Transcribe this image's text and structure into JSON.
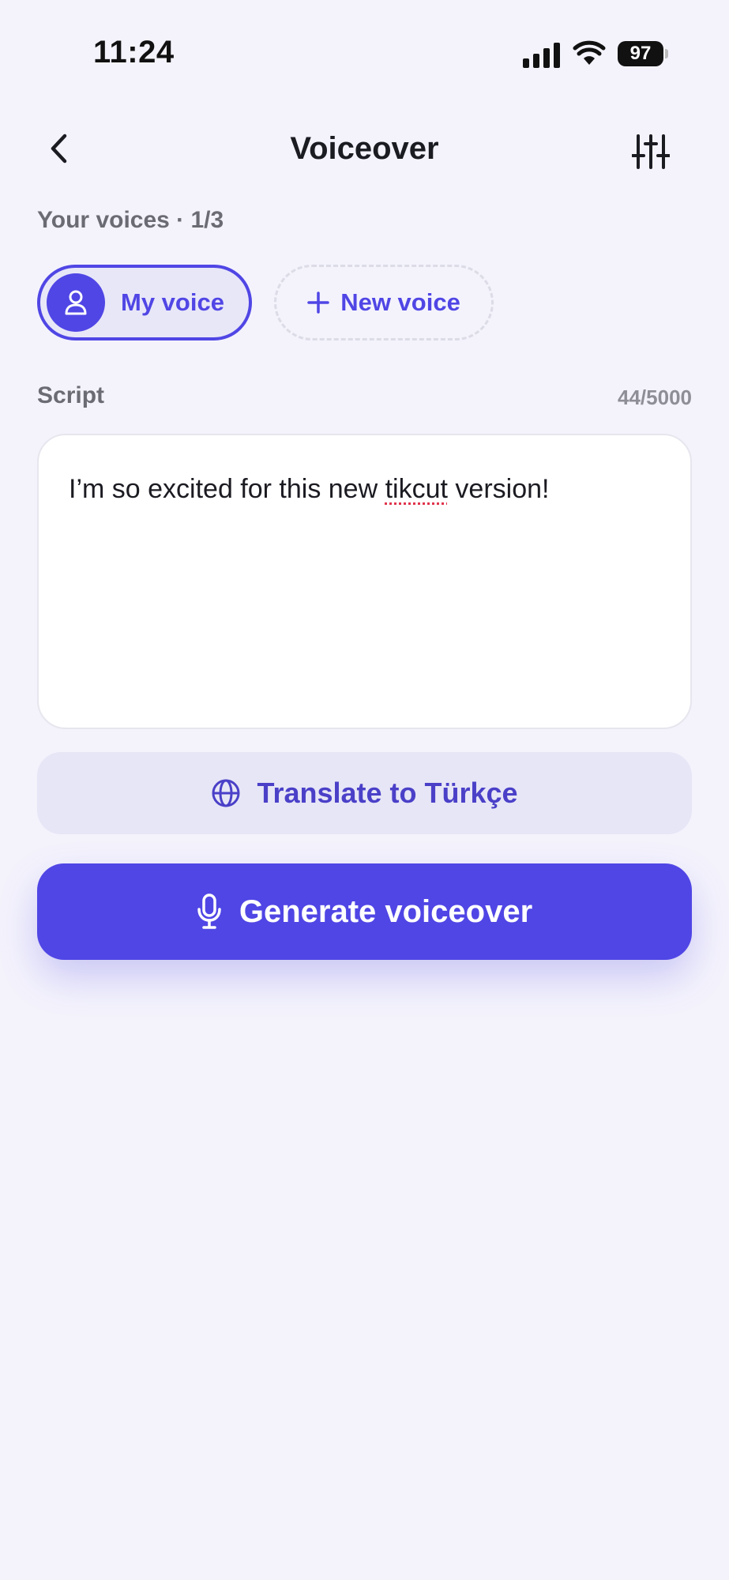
{
  "status_bar": {
    "time": "11:24",
    "battery": "97",
    "icons": [
      "signal-icon",
      "wifi-icon",
      "battery-icon"
    ]
  },
  "header": {
    "title": "Voiceover",
    "back_icon": "chevron-left-icon",
    "settings_icon": "sliders-icon"
  },
  "voices": {
    "label": "Your voices · 1/3",
    "items": [
      {
        "label": "My voice",
        "icon": "person-icon",
        "selected": true
      },
      {
        "label": "New voice",
        "icon": "plus-icon",
        "selected": false
      }
    ]
  },
  "script": {
    "label": "Script",
    "count": "44/5000",
    "text_before": "I’m so excited for this new ",
    "text_misspelled": "tikcut",
    "text_after": " version!"
  },
  "translate": {
    "label": "Translate to Türkçe",
    "icon": "globe-icon"
  },
  "generate": {
    "label": "Generate voiceover",
    "icon": "microphone-icon"
  },
  "colors": {
    "background": "#f4f3fc",
    "accent": "#5046e5",
    "accent_light": "#e7e6f6",
    "muted_text": "#6b6b74"
  }
}
